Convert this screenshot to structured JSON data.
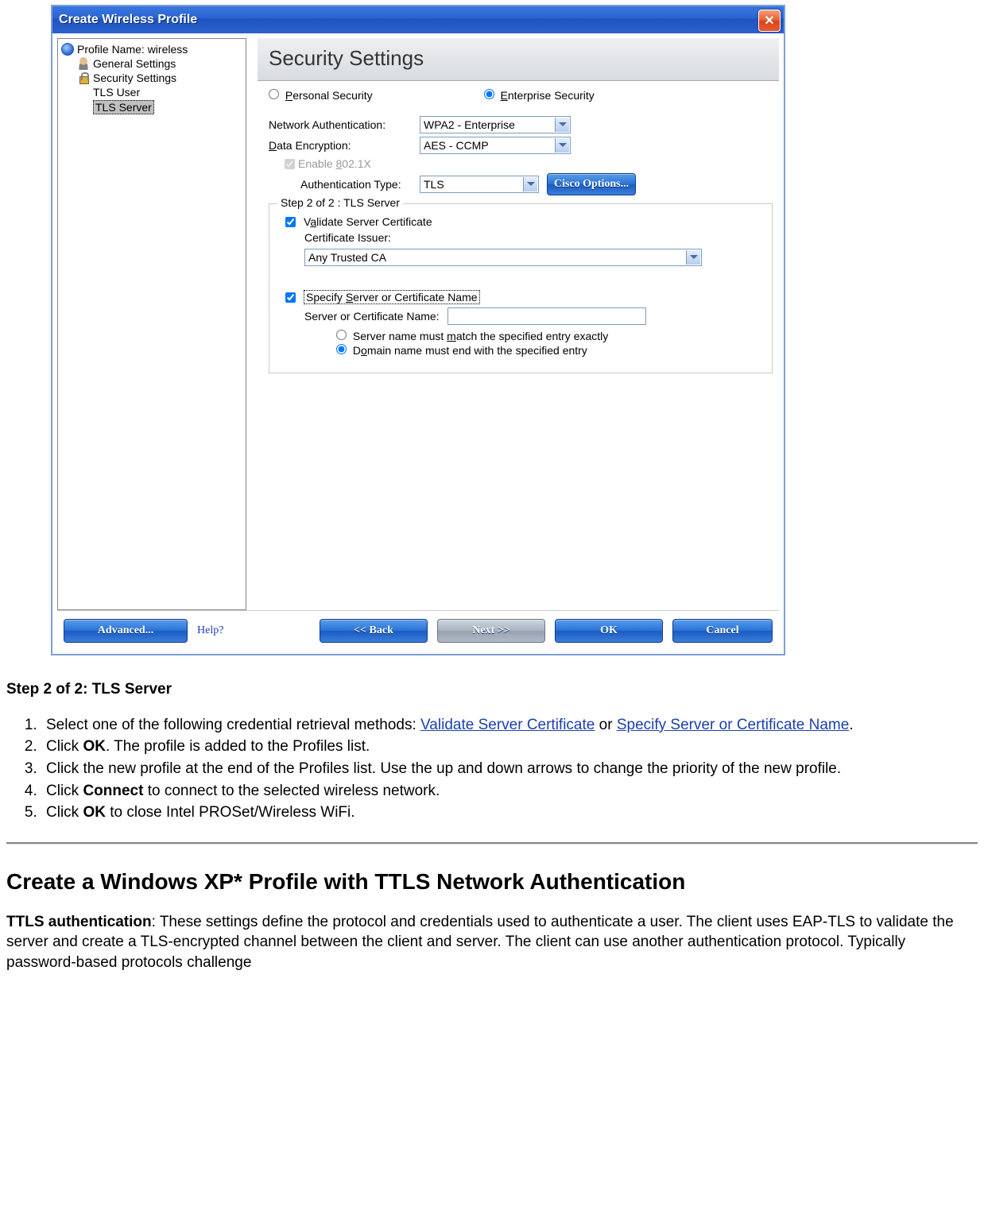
{
  "dialog": {
    "title": "Create Wireless Profile",
    "tree": {
      "profile_label": "Profile Name: wireless",
      "general": "General Settings",
      "security": "Security Settings",
      "tls_user": "TLS User",
      "tls_server": "TLS Server"
    },
    "header": "Security Settings",
    "radios": {
      "personal": "Personal Security",
      "enterprise": "Enterprise Security"
    },
    "net_auth_label": "Network Authentication:",
    "net_auth_value": "WPA2 - Enterprise",
    "data_enc_label": "Data Encryption:",
    "data_enc_value": "AES - CCMP",
    "enable_8021x": "Enable 802.1X",
    "auth_type_label": "Authentication Type:",
    "auth_type_value": "TLS",
    "cisco_btn": "Cisco Options...",
    "fieldset_legend": "Step 2 of 2 : TLS Server",
    "validate_cert": "Validate Server Certificate",
    "cert_issuer_label": "Certificate Issuer:",
    "cert_issuer_value": "Any Trusted CA",
    "specify_server": "Specify Server or Certificate Name",
    "server_name_label": "Server or Certificate Name:",
    "server_name_value": "",
    "match_exact": "Server name must match the specified entry exactly",
    "match_domain": "Domain name must end with the specified entry",
    "buttons": {
      "advanced": "Advanced...",
      "help": "Help?",
      "back": "<< Back",
      "next": "Next >>",
      "ok": "OK",
      "cancel": "Cancel"
    }
  },
  "doc": {
    "step_title": "Step 2 of 2: TLS Server",
    "li1a": "Select one of the following credential retrieval methods: ",
    "li1_link1": "Validate Server Certificate",
    "li1_or": " or ",
    "li1_link2": "Specify Server or Certificate Name",
    "li1_end": ".",
    "li2a": "Click ",
    "li2b": "OK",
    "li2c": ". The profile is added to the Profiles list.",
    "li3": "Click the new profile at the end of the Profiles list. Use the up and down arrows to change the priority of the new profile.",
    "li4a": "Click ",
    "li4b": "Connect",
    "li4c": " to connect to the selected wireless network.",
    "li5a": "Click ",
    "li5b": "OK",
    "li5c": " to close Intel PROSet/Wireless WiFi.",
    "h2": "Create a Windows XP* Profile with TTLS Network Authentication",
    "para_b": "TTLS authentication",
    "para_rest": ": These settings define the protocol and credentials used to authenticate a user. The client uses EAP-TLS to validate the server and create a TLS-encrypted channel between the client and server. The client can use another authentication protocol. Typically password-based protocols challenge"
  }
}
